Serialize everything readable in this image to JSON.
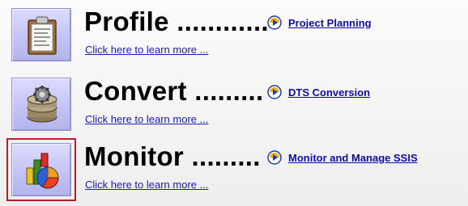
{
  "rows": [
    {
      "icon": "clipboard-icon",
      "title": "Profile ............",
      "learn_more": "Click here to learn more ...",
      "link": "Project Planning"
    },
    {
      "icon": "gear-database-icon",
      "title": "Convert .........",
      "learn_more": "Click here to learn more ...",
      "link": "DTS Conversion"
    },
    {
      "icon": "chart-icon",
      "title": "Monitor .........",
      "learn_more": "Click here to learn more ...",
      "link": "Monitor and Manage SSIS"
    }
  ],
  "colors": {
    "link": "#0d0da8",
    "learn_more": "#1a1ab4",
    "selection_border": "#b72027",
    "tile": "#c3c3f6"
  }
}
